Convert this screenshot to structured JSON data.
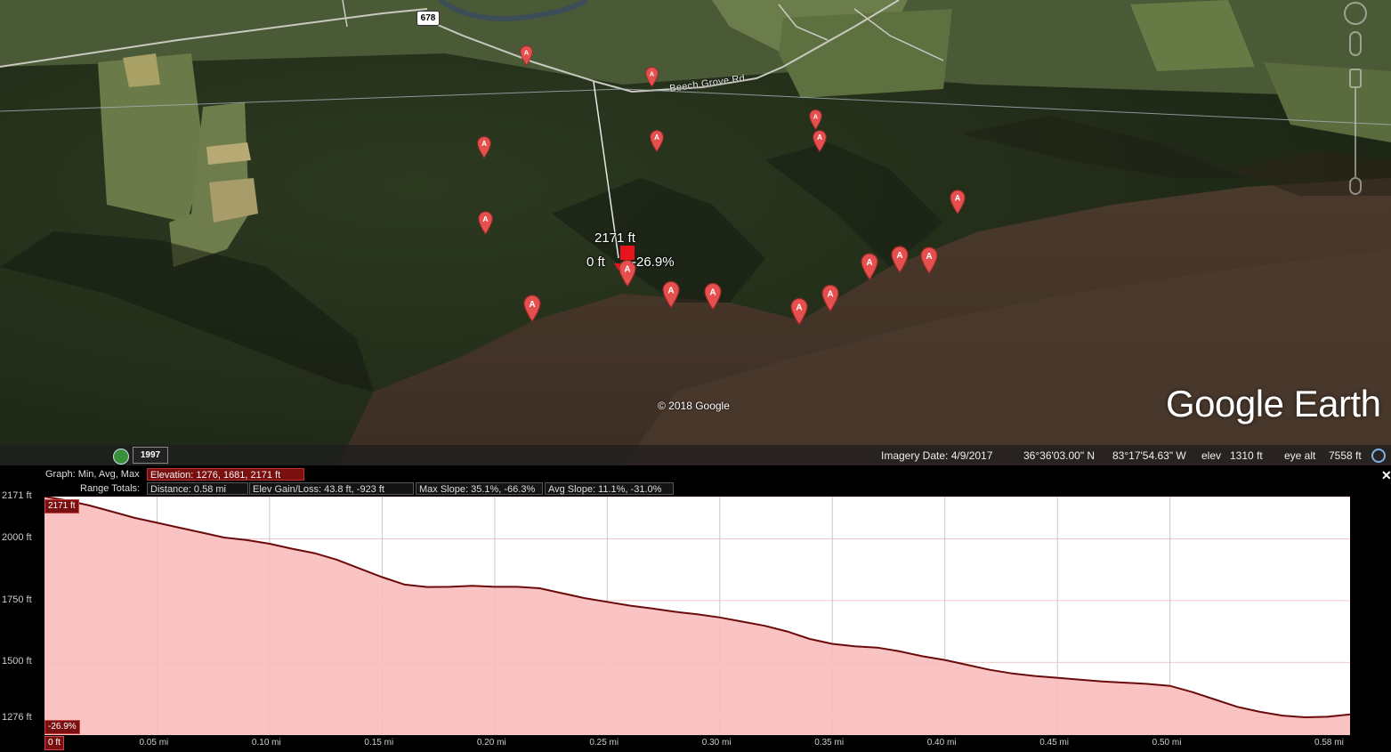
{
  "map": {
    "road_label": "Beech Grove Rd",
    "route_shield": "678",
    "copyright": "© 2018 Google",
    "brand": "Google Earth",
    "probe": {
      "elevation": "2171 ft",
      "distance": "0 ft",
      "slope": "-26.9%"
    },
    "colors": {
      "pin": "#e5504f",
      "profile_line": "#6b0a0a",
      "profile_fill": "#f8bcbc"
    }
  },
  "status": {
    "year": "1997",
    "imagery_date": "Imagery Date: 4/9/2017",
    "lat": "36°36'03.00\" N",
    "lon": "83°17'54.63\" W",
    "elev_label": "elev",
    "elev_value": "1310 ft",
    "eye_label": "eye alt",
    "eye_value": "7558 ft"
  },
  "profile": {
    "graph_label": "Graph:",
    "graph_modes": "Min, Avg, Max",
    "elevation": "Elevation: 1276, 1681, 2171 ft",
    "range_label": "Range Totals:",
    "distance": "Distance: 0.58 mi",
    "gain_loss": "Elev Gain/Loss: 43.8 ft, -923 ft",
    "max_slope": "Max Slope: 35.1%, -66.3%",
    "avg_slope": "Avg Slope: 11.1%, -31.0%",
    "close": "✕",
    "top_tag": "2171 ft",
    "slope_tag": "-26.9%",
    "zero_tag": "0 ft",
    "end_tag": "0.58 mi"
  },
  "chart_data": {
    "type": "area",
    "xlabel": "",
    "ylabel": "",
    "x_unit": "mi",
    "y_unit": "ft",
    "xlim": [
      0,
      0.58
    ],
    "ylim": [
      1206,
      2171
    ],
    "y_ticks": [
      "2171 ft",
      "2000 ft",
      "1750 ft",
      "1500 ft",
      "1276 ft"
    ],
    "y_tick_values": [
      2171,
      2000,
      1750,
      1500,
      1276
    ],
    "x_ticks": [
      "0.05 mi",
      "0.10 mi",
      "0.15 mi",
      "0.20 mi",
      "0.25 mi",
      "0.30 mi",
      "0.35 mi",
      "0.40 mi",
      "0.45 mi",
      "0.50 mi"
    ],
    "x_tick_values": [
      0.05,
      0.1,
      0.15,
      0.2,
      0.25,
      0.3,
      0.35,
      0.4,
      0.45,
      0.5
    ],
    "x": [
      0,
      0.01,
      0.02,
      0.03,
      0.04,
      0.05,
      0.06,
      0.07,
      0.08,
      0.09,
      0.1,
      0.11,
      0.12,
      0.13,
      0.14,
      0.15,
      0.16,
      0.17,
      0.18,
      0.19,
      0.2,
      0.21,
      0.22,
      0.23,
      0.24,
      0.25,
      0.26,
      0.27,
      0.28,
      0.29,
      0.3,
      0.31,
      0.32,
      0.33,
      0.34,
      0.35,
      0.36,
      0.37,
      0.38,
      0.39,
      0.4,
      0.41,
      0.42,
      0.43,
      0.44,
      0.45,
      0.46,
      0.47,
      0.48,
      0.49,
      0.5,
      0.51,
      0.52,
      0.53,
      0.54,
      0.55,
      0.56,
      0.57,
      0.58
    ],
    "y": [
      2171,
      2155,
      2135,
      2110,
      2085,
      2065,
      2045,
      2025,
      2005,
      1995,
      1980,
      1960,
      1942,
      1915,
      1880,
      1845,
      1815,
      1805,
      1806,
      1810,
      1806,
      1806,
      1800,
      1780,
      1760,
      1745,
      1730,
      1718,
      1705,
      1695,
      1682,
      1665,
      1648,
      1625,
      1595,
      1575,
      1565,
      1560,
      1545,
      1525,
      1510,
      1490,
      1470,
      1455,
      1445,
      1438,
      1430,
      1423,
      1418,
      1413,
      1405,
      1380,
      1350,
      1320,
      1300,
      1285,
      1278,
      1280,
      1290
    ],
    "series": [
      {
        "values_ref": "y"
      }
    ],
    "grid": true,
    "legend": "none"
  }
}
